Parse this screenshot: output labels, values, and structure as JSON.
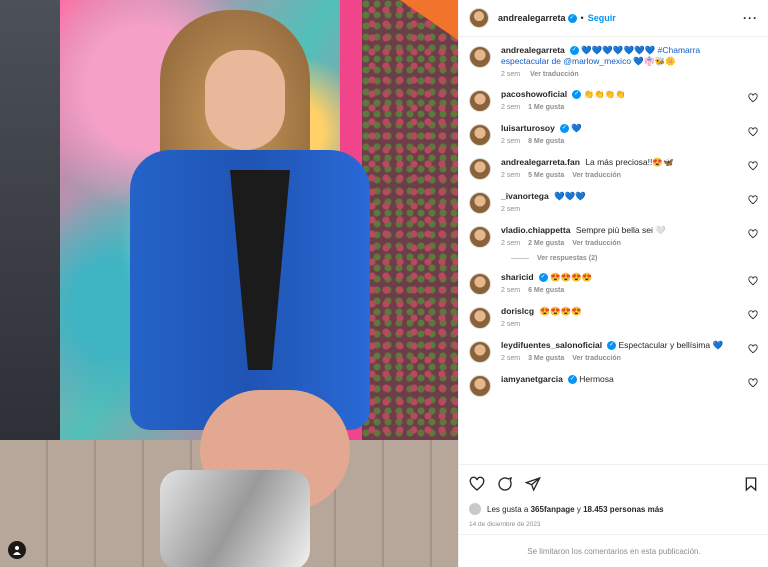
{
  "post": {
    "author": "andrealegarreta",
    "follow_label": "Seguir",
    "caption_user": "andrealegarreta",
    "caption_text": "💙💙💙💙💙💙💙 #Chamarra espectacular de @marlow_mexico 💙👘🐝🌼",
    "caption_time": "2 sem",
    "caption_translate": "Ver traducción"
  },
  "comments": [
    {
      "user": "pacoshowoficial",
      "text": "👏👏👏👏",
      "time": "2 sem",
      "likes": "1 Me gusta",
      "translate": ""
    },
    {
      "user": "luisarturosoy",
      "text": "💙",
      "time": "2 sem",
      "likes": "8 Me gusta",
      "translate": ""
    },
    {
      "user": "andrealegarreta.fan",
      "text": "La más preciosa!!😍🦋",
      "time": "2 sem",
      "likes": "5 Me gusta",
      "translate": "Ver traducción"
    },
    {
      "user": "_ivanortega",
      "text": "💙💙💙",
      "time": "2 sem",
      "likes": "",
      "translate": ""
    },
    {
      "user": "vladio.chiappetta",
      "text": "Sempre più bella sei 🤍",
      "time": "2 sem",
      "likes": "2 Me gusta",
      "translate": "Ver traducción"
    },
    {
      "user": "sharicid",
      "text": "😍😍😍😍",
      "time": "2 sem",
      "likes": "6 Me gusta",
      "translate": ""
    },
    {
      "user": "dorislcg",
      "text": "😍😍😍😍",
      "time": "2 sem",
      "likes": "",
      "translate": ""
    },
    {
      "user": "leydifuentes_salonoficial",
      "text": "Espectacular y bellísima 💙",
      "time": "2 sem",
      "likes": "3 Me gusta",
      "translate": "Ver traducción"
    },
    {
      "user": "iamyanetgarcia",
      "text": "Hermosa",
      "time": "",
      "likes": "",
      "translate": ""
    }
  ],
  "replies_label": "Ver respuestas (2)",
  "likes": {
    "prefix": "Les gusta a",
    "user": "365fanpage",
    "middle": "y",
    "count": "18.453 personas más"
  },
  "date": "14 de diciembre de 2023",
  "comments_disabled": "Se limitaron los comentarios en esta publicación.",
  "colors": {
    "accent": "#0095f6",
    "verified": "#0095f6"
  }
}
